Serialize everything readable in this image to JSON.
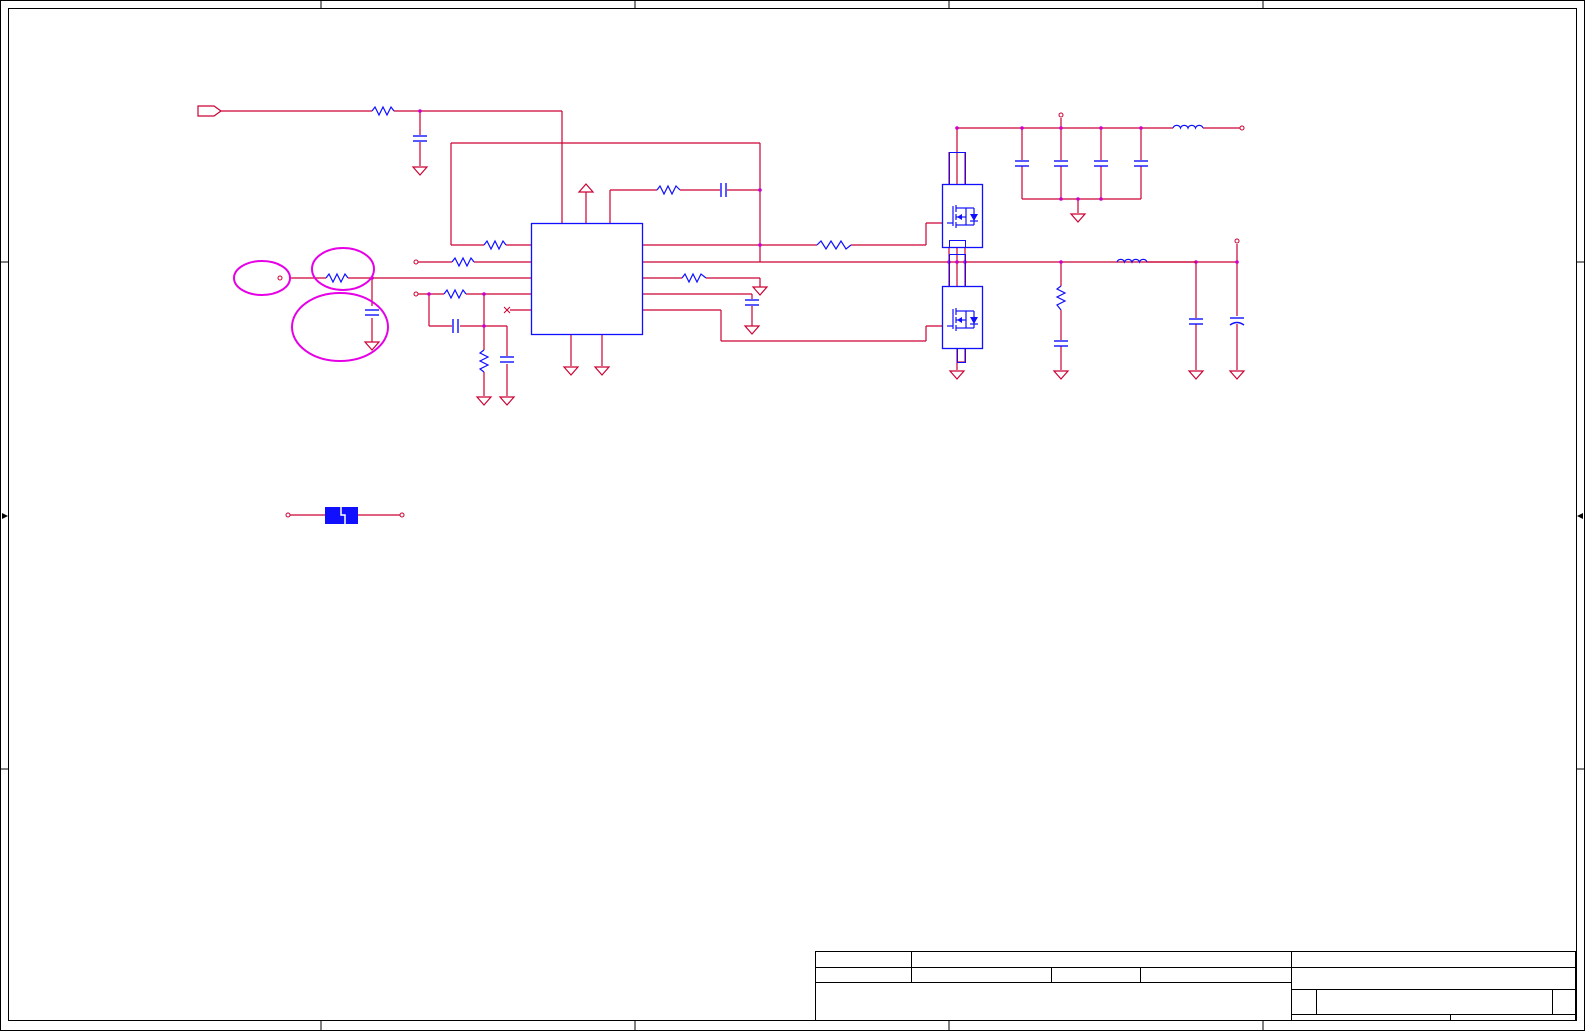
{
  "sheet": {
    "wire_color": "#cc0033",
    "component_color": "#1010ff",
    "annotation_color": "#e600e6",
    "junction_color": "#cc00cc",
    "frame_color": "#000000"
  },
  "title_block": {
    "company": "",
    "title": "",
    "size": "",
    "document_number": "",
    "revision": "",
    "date": "",
    "sheet": ""
  }
}
